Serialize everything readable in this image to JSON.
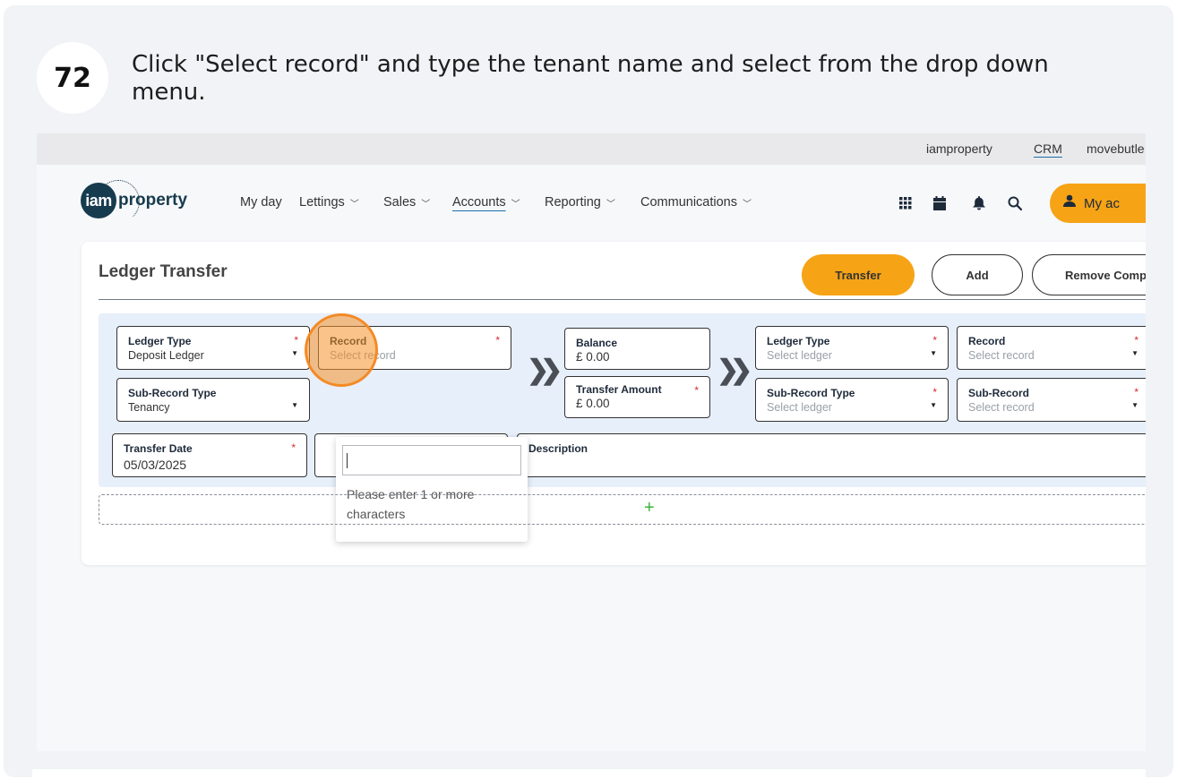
{
  "step": {
    "number": "72",
    "instruction": "Click \"Select record\" and type the tenant name and select from the drop down menu."
  },
  "topbar": {
    "links": [
      "iamproperty",
      "CRM",
      "movebutle"
    ]
  },
  "logo": {
    "part1": "iam",
    "part2": "property"
  },
  "nav": {
    "items": [
      {
        "label": "My day"
      },
      {
        "label": "Lettings"
      },
      {
        "label": "Sales"
      },
      {
        "label": "Accounts"
      },
      {
        "label": "Reporting"
      },
      {
        "label": "Communications"
      }
    ]
  },
  "header_actions": {
    "my_account": "My ac"
  },
  "page": {
    "title": "Ledger Transfer",
    "buttons": {
      "transfer": "Transfer",
      "add": "Add",
      "remove": "Remove Comp"
    }
  },
  "form": {
    "left": {
      "ledger_type": {
        "label": "Ledger Type",
        "value": "Deposit Ledger"
      },
      "record": {
        "label": "Record",
        "placeholder": "Select record"
      },
      "sub_record_type": {
        "label": "Sub-Record Type",
        "value": "Tenancy"
      }
    },
    "balance": {
      "label": "Balance",
      "value": "£ 0.00"
    },
    "transfer_amount": {
      "label": "Transfer Amount",
      "value": "£ 0.00"
    },
    "right": {
      "ledger_type": {
        "label": "Ledger Type",
        "placeholder": "Select ledger"
      },
      "record": {
        "label": "Record",
        "placeholder": "Select record"
      },
      "sub_record_type": {
        "label": "Sub-Record Type",
        "placeholder": "Select ledger"
      },
      "sub_record": {
        "label": "Sub-Record",
        "placeholder": "Select record"
      }
    },
    "transfer_date": {
      "label": "Transfer Date",
      "value": "05/03/2025"
    },
    "description": {
      "label": "Description"
    },
    "required_mark": "*",
    "dropdown_mark": "▼",
    "arrow_glyph": "❯❯"
  },
  "dropdown": {
    "message": "Please enter 1 or more characters"
  },
  "add_row": {
    "plus": "+"
  },
  "colors": {
    "accent": "#f6a316",
    "brand": "#173b4e",
    "required": "#d9282f",
    "highlight": "#f38a26",
    "plus": "#3bb43b"
  }
}
